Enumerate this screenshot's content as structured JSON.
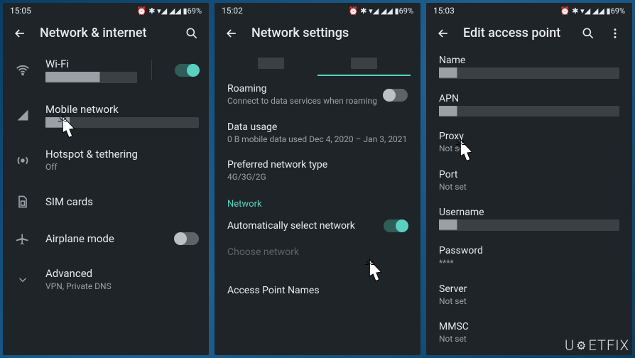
{
  "screens": [
    {
      "status": {
        "time": "15:05",
        "icons": "⏰ ✱ ▾◢ ◢◢ ▮69%"
      },
      "appbar": {
        "title": "Network & internet",
        "has_search": true,
        "has_more": false
      },
      "items": [
        {
          "icon": "wifi",
          "label": "Wi-Fi",
          "sub": "█████████",
          "sub_redacted": true,
          "toggle": "on",
          "toggle_divider": true
        },
        {
          "icon": "signal",
          "label": "Mobile network",
          "sub": "████",
          "sub_redacted": true,
          "cursor": true
        },
        {
          "icon": "hotspot",
          "label": "Hotspot & tethering",
          "sub": "Off"
        },
        {
          "icon": "sim",
          "label": "SIM cards",
          "sub": ""
        },
        {
          "icon": "airplane",
          "label": "Airplane mode",
          "sub": "",
          "toggle": "off"
        },
        {
          "icon": "expand",
          "label": "Advanced",
          "sub": "VPN, Private DNS"
        }
      ]
    },
    {
      "status": {
        "time": "15:02",
        "icons": "⏰ ✱ ▾◢ ◢◢ ▮69%"
      },
      "appbar": {
        "title": "Network settings",
        "has_search": false,
        "has_more": false
      },
      "tabs": [
        {
          "label": "████",
          "redacted": true,
          "active": false
        },
        {
          "label": "████",
          "redacted": true,
          "active": true
        }
      ],
      "items": [
        {
          "label": "Roaming",
          "sub": "Connect to data services when roaming",
          "toggle": "off"
        },
        {
          "label": "Data usage",
          "sub": "0 B mobile data used Dec 4, 2020 – Jan 3, 2021"
        },
        {
          "label": "Preferred network type",
          "sub": "4G/3G/2G"
        }
      ],
      "section_header": "Network",
      "items2": [
        {
          "label": "Automatically select network",
          "sub": "",
          "toggle": "on"
        },
        {
          "label": "Choose network",
          "sub": "",
          "disabled": true
        },
        {
          "label": "Access Point Names",
          "sub": "",
          "cursor": true
        }
      ]
    },
    {
      "status": {
        "time": "15:03",
        "icons": "⏰ ✱ ▾◢ ◢◢ ▮69%"
      },
      "appbar": {
        "title": "Edit access point",
        "has_search": true,
        "has_more": true
      },
      "fields": [
        {
          "label": "Name",
          "value": "███",
          "redacted": true
        },
        {
          "label": "APN",
          "value": "███",
          "redacted": true
        },
        {
          "label": "Proxy",
          "value": "Not set",
          "cursor": true
        },
        {
          "label": "Port",
          "value": "Not set"
        },
        {
          "label": "Username",
          "value": "███",
          "redacted": true
        },
        {
          "label": "Password",
          "value": "****"
        },
        {
          "label": "Server",
          "value": "Not set"
        },
        {
          "label": "MMSC",
          "value": "Not set"
        }
      ]
    }
  ],
  "watermark": "UGETFIX"
}
